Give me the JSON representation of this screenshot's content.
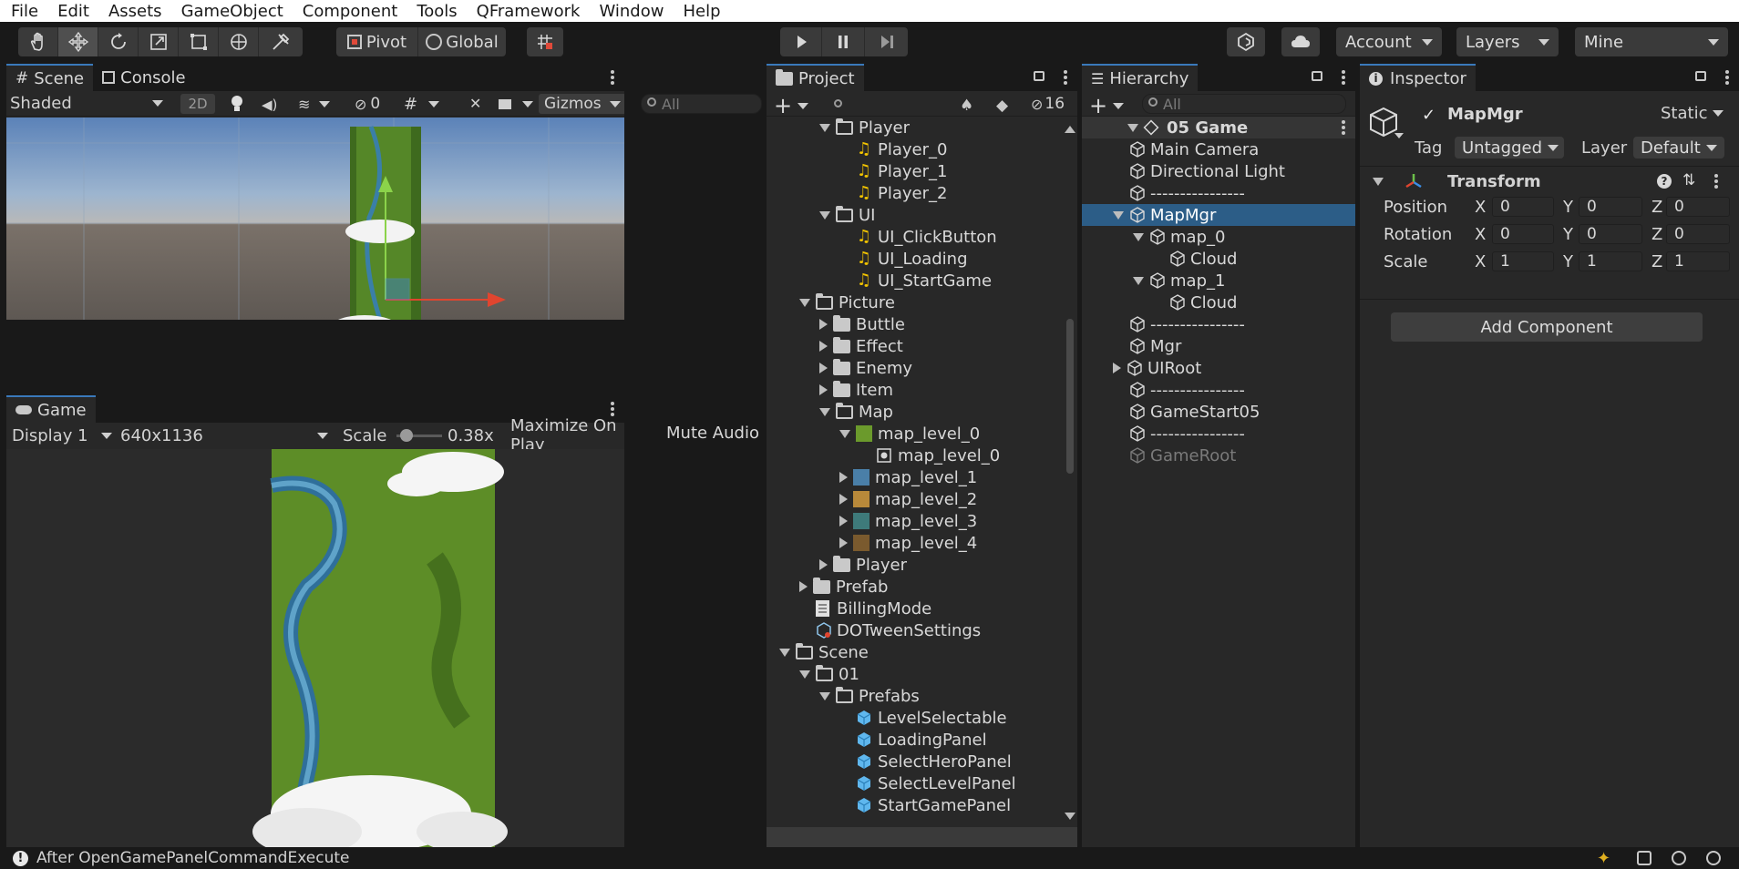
{
  "menu": [
    "File",
    "Edit",
    "Assets",
    "GameObject",
    "Component",
    "Tools",
    "QFramework",
    "Window",
    "Help"
  ],
  "toolbar": {
    "pivot": "Pivot",
    "global": "Global",
    "account": "Account",
    "layers": "Layers",
    "layout": "Mine"
  },
  "scene": {
    "tab_scene": "Scene",
    "tab_console": "Console",
    "shading": "Shaded",
    "mode_2d": "2D",
    "hidden_count": "0",
    "gizmos": "Gizmos",
    "search_placeholder": "All"
  },
  "game": {
    "tab": "Game",
    "display": "Display 1",
    "resolution": "640x1136",
    "scale_label": "Scale",
    "scale_value": "0.38x",
    "maximize": "Maximize On Play",
    "mute": "Mute Audio"
  },
  "project": {
    "tab": "Project",
    "hidden_count": "16",
    "rows": [
      {
        "label": "Player",
        "indent": 3,
        "icon": "folder-open",
        "arrow": "down"
      },
      {
        "label": "Player_0",
        "indent": 4,
        "icon": "audio",
        "arrow": ""
      },
      {
        "label": "Player_1",
        "indent": 4,
        "icon": "audio",
        "arrow": ""
      },
      {
        "label": "Player_2",
        "indent": 4,
        "icon": "audio",
        "arrow": ""
      },
      {
        "label": "UI",
        "indent": 3,
        "icon": "folder-open",
        "arrow": "down"
      },
      {
        "label": "UI_ClickButton",
        "indent": 4,
        "icon": "audio",
        "arrow": ""
      },
      {
        "label": "UI_Loading",
        "indent": 4,
        "icon": "audio",
        "arrow": ""
      },
      {
        "label": "UI_StartGame",
        "indent": 4,
        "icon": "audio",
        "arrow": ""
      },
      {
        "label": "Picture",
        "indent": 2,
        "icon": "folder-open",
        "arrow": "down"
      },
      {
        "label": "Buttle",
        "indent": 3,
        "icon": "folder",
        "arrow": "right"
      },
      {
        "label": "Effect",
        "indent": 3,
        "icon": "folder",
        "arrow": "right"
      },
      {
        "label": "Enemy",
        "indent": 3,
        "icon": "folder",
        "arrow": "right"
      },
      {
        "label": "Item",
        "indent": 3,
        "icon": "folder",
        "arrow": "right"
      },
      {
        "label": "Map",
        "indent": 3,
        "icon": "folder-open",
        "arrow": "down"
      },
      {
        "label": "map_level_0",
        "indent": 4,
        "icon": "thumb-green",
        "arrow": "down"
      },
      {
        "label": "map_level_0",
        "indent": 5,
        "icon": "sprite",
        "arrow": ""
      },
      {
        "label": "map_level_1",
        "indent": 4,
        "icon": "thumb-blue",
        "arrow": "right"
      },
      {
        "label": "map_level_2",
        "indent": 4,
        "icon": "thumb-orange",
        "arrow": "right"
      },
      {
        "label": "map_level_3",
        "indent": 4,
        "icon": "thumb-teal",
        "arrow": "right"
      },
      {
        "label": "map_level_4",
        "indent": 4,
        "icon": "thumb-brown",
        "arrow": "right"
      },
      {
        "label": "Player",
        "indent": 3,
        "icon": "folder",
        "arrow": "right"
      },
      {
        "label": "Prefab",
        "indent": 2,
        "icon": "folder",
        "arrow": "right"
      },
      {
        "label": "BillingMode",
        "indent": 2,
        "icon": "doc",
        "arrow": ""
      },
      {
        "label": "DOTweenSettings",
        "indent": 2,
        "icon": "settings",
        "arrow": ""
      },
      {
        "label": "Scene",
        "indent": 1,
        "icon": "folder-open",
        "arrow": "down"
      },
      {
        "label": "01",
        "indent": 2,
        "icon": "folder-open",
        "arrow": "down"
      },
      {
        "label": "Prefabs",
        "indent": 3,
        "icon": "folder-open",
        "arrow": "down"
      },
      {
        "label": "LevelSelectable",
        "indent": 4,
        "icon": "prefab",
        "arrow": ""
      },
      {
        "label": "LoadingPanel",
        "indent": 4,
        "icon": "prefab",
        "arrow": ""
      },
      {
        "label": "SelectHeroPanel",
        "indent": 4,
        "icon": "prefab",
        "arrow": ""
      },
      {
        "label": "SelectLevelPanel",
        "indent": 4,
        "icon": "prefab",
        "arrow": ""
      },
      {
        "label": "StartGamePanel",
        "indent": 4,
        "icon": "prefab",
        "arrow": ""
      }
    ]
  },
  "hierarchy": {
    "tab": "Hierarchy",
    "search_placeholder": "All",
    "scene_name": "05 Game",
    "rows": [
      {
        "label": "Main Camera",
        "indent": 1,
        "arrow": "",
        "selected": false,
        "dim": false
      },
      {
        "label": "Directional Light",
        "indent": 1,
        "arrow": "",
        "selected": false,
        "dim": false
      },
      {
        "label": "----------------",
        "indent": 1,
        "arrow": "",
        "selected": false,
        "dim": false
      },
      {
        "label": "MapMgr",
        "indent": 1,
        "arrow": "down",
        "selected": true,
        "dim": false
      },
      {
        "label": "map_0",
        "indent": 2,
        "arrow": "down",
        "selected": false,
        "dim": false
      },
      {
        "label": "Cloud",
        "indent": 3,
        "arrow": "",
        "selected": false,
        "dim": false
      },
      {
        "label": "map_1",
        "indent": 2,
        "arrow": "down",
        "selected": false,
        "dim": false
      },
      {
        "label": "Cloud",
        "indent": 3,
        "arrow": "",
        "selected": false,
        "dim": false
      },
      {
        "label": "----------------",
        "indent": 1,
        "arrow": "",
        "selected": false,
        "dim": false
      },
      {
        "label": "Mgr",
        "indent": 1,
        "arrow": "",
        "selected": false,
        "dim": false
      },
      {
        "label": "UIRoot",
        "indent": 1,
        "arrow": "right",
        "selected": false,
        "dim": false
      },
      {
        "label": "----------------",
        "indent": 1,
        "arrow": "",
        "selected": false,
        "dim": false
      },
      {
        "label": "GameStart05",
        "indent": 1,
        "arrow": "",
        "selected": false,
        "dim": false
      },
      {
        "label": "----------------",
        "indent": 1,
        "arrow": "",
        "selected": false,
        "dim": false
      },
      {
        "label": "GameRoot",
        "indent": 1,
        "arrow": "",
        "selected": false,
        "dim": true
      }
    ]
  },
  "inspector": {
    "tab": "Inspector",
    "object_name": "MapMgr",
    "static_label": "Static",
    "tag_label": "Tag",
    "tag_value": "Untagged",
    "layer_label": "Layer",
    "layer_value": "Default",
    "transform_title": "Transform",
    "position_label": "Position",
    "rotation_label": "Rotation",
    "scale_label": "Scale",
    "axis_x": "X",
    "axis_y": "Y",
    "axis_z": "Z",
    "position": {
      "x": "0",
      "y": "0",
      "z": "0"
    },
    "rotation": {
      "x": "0",
      "y": "0",
      "z": "0"
    },
    "scale": {
      "x": "1",
      "y": "1",
      "z": "1"
    },
    "add_component": "Add Component"
  },
  "status": {
    "message": "After OpenGamePanelCommandExecute"
  },
  "colors": {
    "accent": "#3a79bb",
    "selection": "#2c5d87",
    "panel": "#282828",
    "chrome": "#191919"
  }
}
